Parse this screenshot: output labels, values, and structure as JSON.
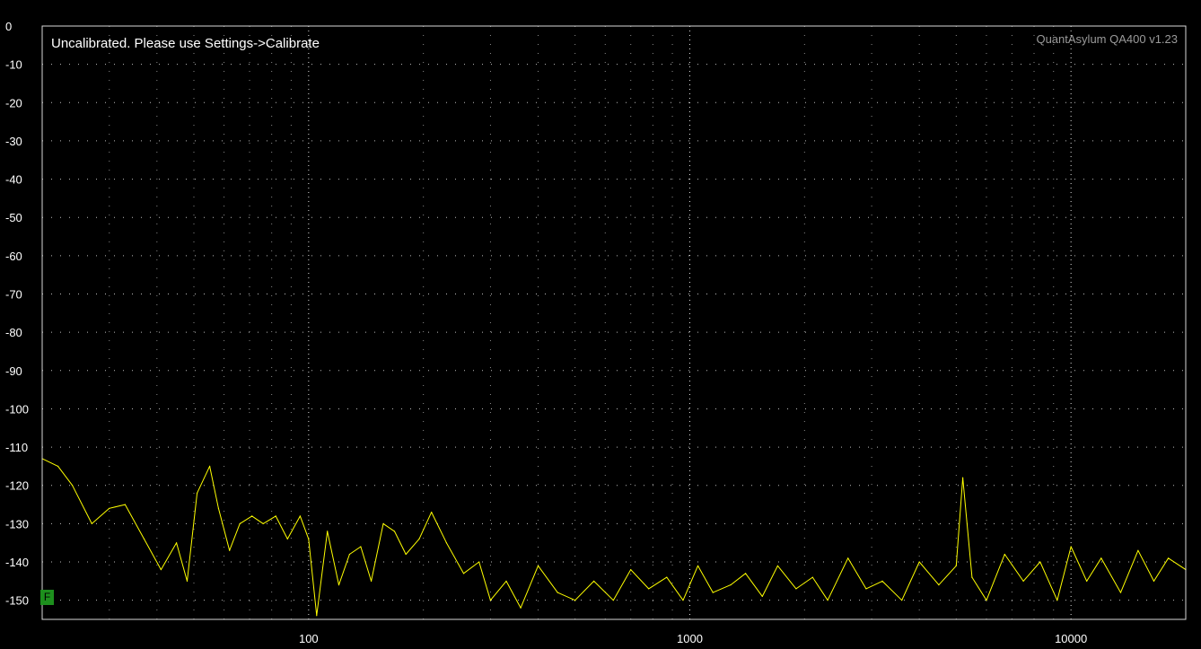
{
  "status_message": "Uncalibrated. Please use Settings->Calibrate",
  "brand_label": "QuantAsylum QA400 v1.23",
  "marker_label": "F",
  "colors": {
    "background": "#000000",
    "trace": "#ffff00",
    "grid": "#bdbdbd",
    "axis_text": "#ffffff",
    "marker": "#1d8f1d"
  },
  "chart_data": {
    "type": "line",
    "title": "",
    "xlabel": "",
    "ylabel": "",
    "x_scale": "log",
    "xlim": [
      20,
      20000
    ],
    "ylim": [
      -155,
      0
    ],
    "grid": true,
    "x_ticks": [
      100,
      1000,
      10000
    ],
    "x_tick_labels": [
      "100",
      "1000",
      "10000"
    ],
    "y_ticks": [
      0,
      -10,
      -20,
      -30,
      -40,
      -50,
      -60,
      -70,
      -80,
      -90,
      -100,
      -110,
      -120,
      -130,
      -140,
      -150
    ],
    "y_tick_labels": [
      "0",
      "-10",
      "-20",
      "-30",
      "-40",
      "-50",
      "-60",
      "-70",
      "-80",
      "-90",
      "-100",
      "-110",
      "-120",
      "-130",
      "-140",
      "-150"
    ],
    "series": [
      {
        "color": "#ffff00",
        "x": [
          20,
          22,
          24,
          27,
          30,
          33,
          37,
          41,
          45,
          48,
          51,
          55,
          58,
          62,
          66,
          71,
          76,
          82,
          88,
          95,
          100,
          105,
          112,
          120,
          128,
          137,
          146,
          157,
          168,
          180,
          195,
          210,
          230,
          255,
          280,
          300,
          330,
          360,
          400,
          450,
          500,
          560,
          630,
          700,
          780,
          870,
          960,
          1050,
          1150,
          1280,
          1400,
          1550,
          1700,
          1900,
          2100,
          2300,
          2600,
          2900,
          3200,
          3600,
          4000,
          4500,
          5000,
          5200,
          5500,
          6000,
          6700,
          7500,
          8300,
          9200,
          10000,
          11000,
          12000,
          13500,
          15000,
          16500,
          18000,
          20000
        ],
        "y": [
          -113,
          -115,
          -120,
          -130,
          -126,
          -125,
          -134,
          -142,
          -135,
          -145,
          -122,
          -115,
          -126,
          -137,
          -130,
          -128,
          -130,
          -128,
          -134,
          -128,
          -134,
          -154,
          -132,
          -146,
          -138,
          -136,
          -145,
          -130,
          -132,
          -138,
          -134,
          -127,
          -135,
          -143,
          -140,
          -150,
          -145,
          -152,
          -141,
          -148,
          -150,
          -145,
          -150,
          -142,
          -147,
          -144,
          -150,
          -141,
          -148,
          -146,
          -143,
          -149,
          -141,
          -147,
          -144,
          -150,
          -139,
          -147,
          -145,
          -150,
          -140,
          -146,
          -141,
          -118,
          -144,
          -150,
          -138,
          -145,
          -140,
          -150,
          -136,
          -145,
          -139,
          -148,
          -137,
          -145,
          -139,
          -142
        ]
      }
    ]
  }
}
